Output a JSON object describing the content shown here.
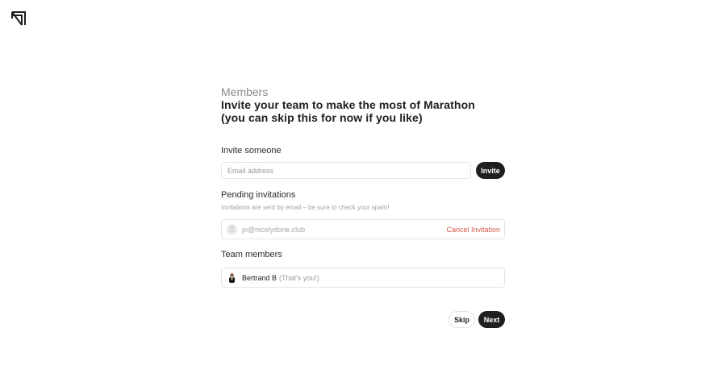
{
  "header": {
    "logo_icon": "marathon-logo-icon"
  },
  "intro": {
    "kicker": "Members",
    "title_line1": "Invite your team to make the most of Marathon",
    "title_line2": "(you can skip this for now if you like)"
  },
  "invite": {
    "label": "Invite someone",
    "email_placeholder": "Email address",
    "email_value": "",
    "invite_button": "Invite"
  },
  "pending": {
    "label": "Pending invitations",
    "hint": "Invitations are sent by email – be sure to check your spam!",
    "items": [
      {
        "email": "jo@nicelydone.club",
        "cancel_label": "Cancel Invitation"
      }
    ]
  },
  "team": {
    "label": "Team members",
    "members": [
      {
        "name": "Bertrand B",
        "suffix": "(That's you!)"
      }
    ]
  },
  "footer": {
    "skip_label": "Skip",
    "next_label": "Next"
  },
  "colors": {
    "primary_dark": "#1f1f1f",
    "danger": "#d65a4a",
    "muted_text": "#9a9a9a",
    "border": "#e6e6e6"
  }
}
